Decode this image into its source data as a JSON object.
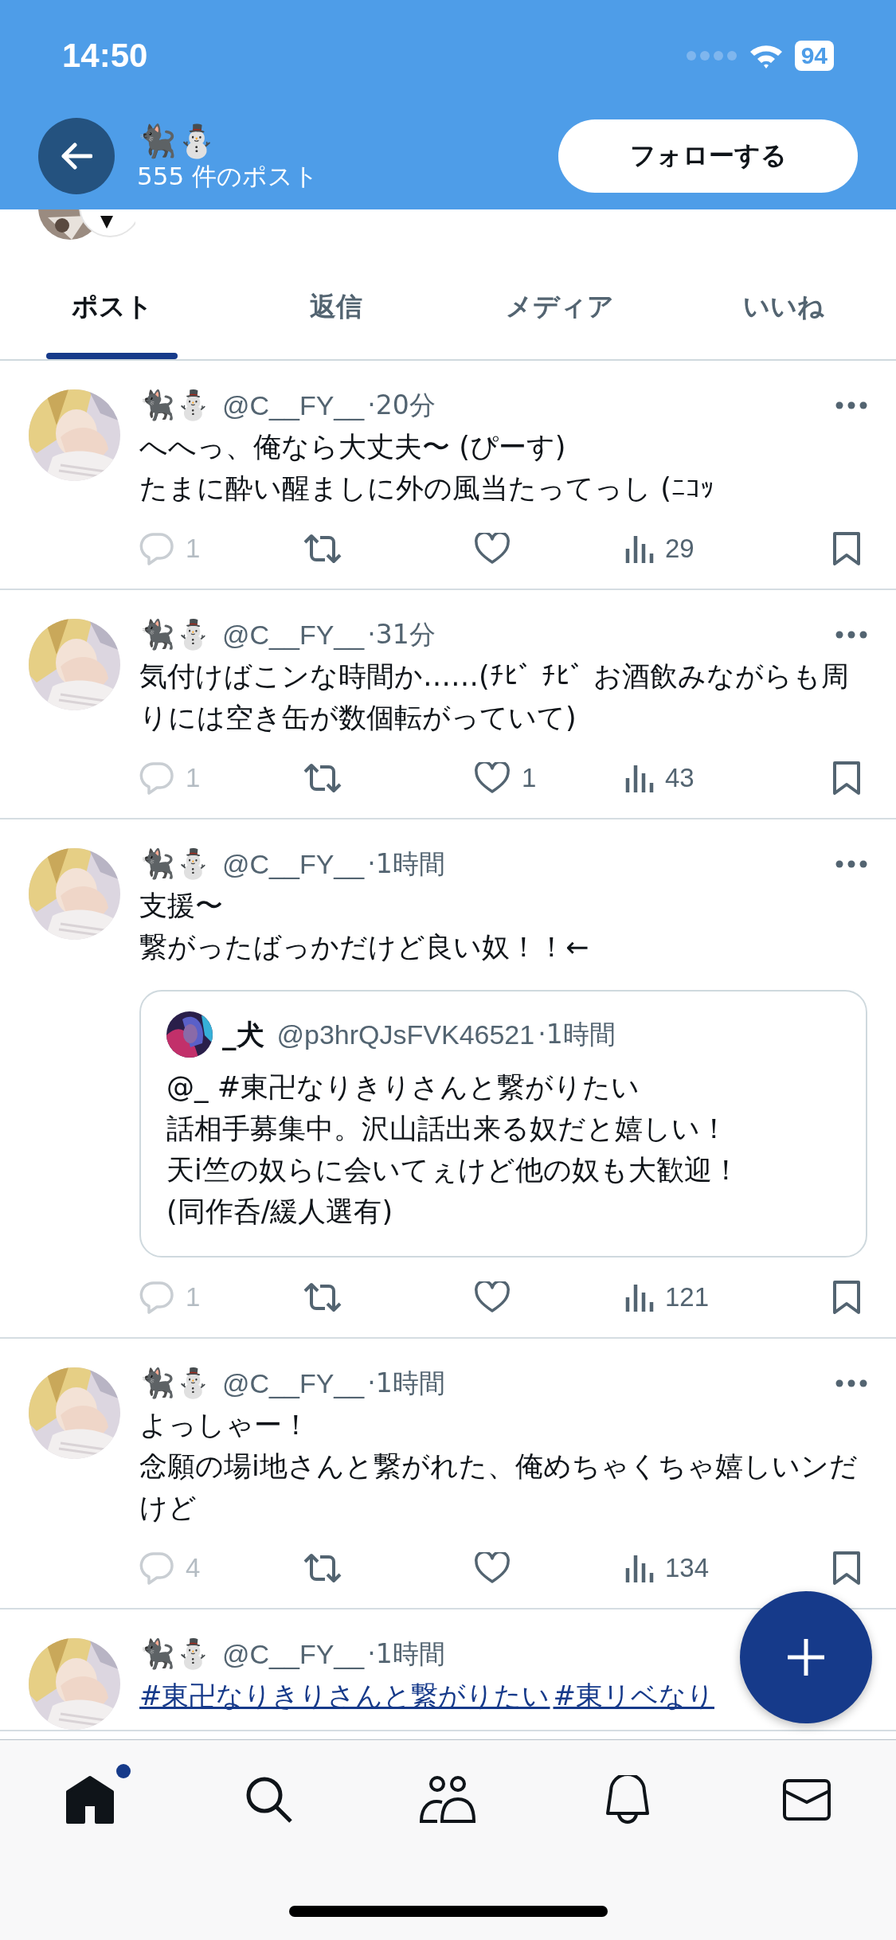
{
  "status_bar": {
    "time": "14:50",
    "battery": "94"
  },
  "header": {
    "name": "🐈‍⬛⛄",
    "post_count": "555 件のポスト",
    "follow_button": "フォローする"
  },
  "tabs": [
    {
      "label": "ポスト",
      "selected": true
    },
    {
      "label": "返信",
      "selected": false
    },
    {
      "label": "メディア",
      "selected": false
    },
    {
      "label": "いいね",
      "selected": false
    }
  ],
  "posts": [
    {
      "name": "🐈‍⬛⛄",
      "handle": "@C__FY__",
      "time": "·20分",
      "paragraphs": [
        "へへっ、俺なら大丈夫〜 (ぴーす)",
        "たまに酔い醒ましに外の風当たってっし (ﾆｺｯ"
      ],
      "replies": "1",
      "views": "29"
    },
    {
      "name": "🐈‍⬛⛄",
      "handle": "@C__FY__",
      "time": "·31分",
      "paragraphs": [
        "気付けばこンな時間か……(ﾁﾋﾞ ﾁﾋﾞ お酒飲みながらも周りには空き缶が数個転がっていて)"
      ],
      "replies": "1",
      "likes": "1",
      "views": "43"
    },
    {
      "name": "🐈‍⬛⛄",
      "handle": "@C__FY__",
      "time": "·1時間",
      "paragraphs": [
        "支援〜",
        "繋がったばっかだけど良い奴！！←"
      ],
      "quote": {
        "name": "_犬",
        "handle": "@p3hrQJsFVK46521",
        "time": "·1時間",
        "paragraphs": [
          "@_  #東卍なりきりさんと繋がりたい",
          "話相手募集中。沢山話出来る奴だと嬉しい！",
          "天i竺の奴らに会いてぇけど他の奴も大歓迎！",
          "(同作呑/緩人選有)"
        ]
      },
      "replies": "1",
      "views": "121"
    },
    {
      "name": "🐈‍⬛⛄",
      "handle": "@C__FY__",
      "time": "·1時間",
      "paragraphs": [
        "よっしゃー！",
        "念願の場i地さんと繋がれた、俺めちゃくちゃ嬉しいンだけど"
      ],
      "replies": "4",
      "views": "134"
    },
    {
      "name": "🐈‍⬛⛄",
      "handle": "@C__FY__",
      "time": "·1時間",
      "hashtags": [
        "#東卍なりきりさんと繋がりたい",
        "#東リベなり"
      ]
    }
  ],
  "nav": [
    {
      "kind": "home",
      "selected": true,
      "dot": true
    },
    {
      "kind": "search",
      "selected": false,
      "dot": false
    },
    {
      "kind": "people",
      "selected": false,
      "dot": false
    },
    {
      "kind": "bell",
      "selected": false,
      "dot": false
    },
    {
      "kind": "mail",
      "selected": false,
      "dot": false
    }
  ]
}
